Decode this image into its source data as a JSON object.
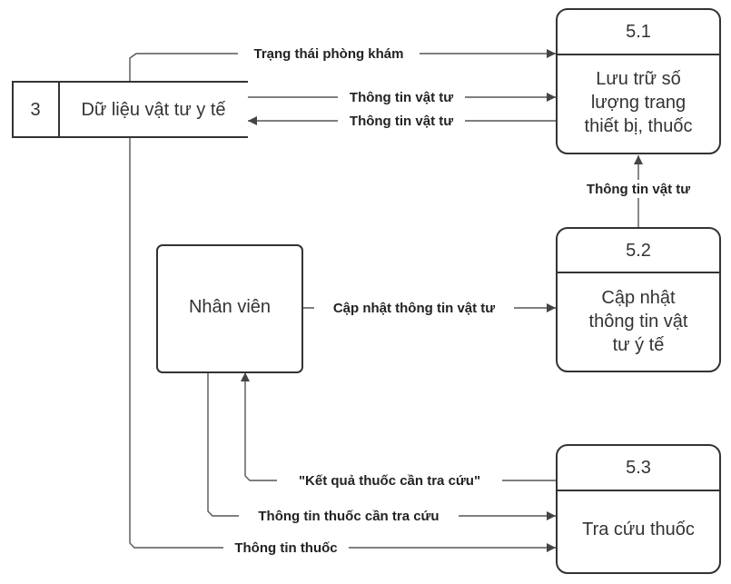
{
  "processes": [
    {
      "id": "5.1",
      "lines": [
        "Lưu trữ số",
        "lượng trang",
        "thiết bị, thuốc"
      ]
    },
    {
      "id": "5.2",
      "lines": [
        "Cập nhật",
        "thông tin vật",
        "tư ý tế"
      ]
    },
    {
      "id": "5.3",
      "lines": [
        "Tra cứu thuốc"
      ]
    }
  ],
  "datastore": {
    "id": "3",
    "name": "Dữ liệu vật tư y tế"
  },
  "entity": {
    "name": "Nhân viên"
  },
  "flows": {
    "trang_thai": "Trạng thái phòng khám",
    "ttvt_to_51": "Thông tin vật tư",
    "ttvt_from_51": "Thông tin vật tư",
    "ttvt_52_51": "Thông tin vật tư",
    "cap_nhat": "Cập nhật thông tin vật tư",
    "ket_qua": "\"Kết quả thuốc cần tra cứu\"",
    "tt_thuoc_can": "Thông tin thuốc cần tra cứu",
    "tt_thuoc": "Thông tin thuốc"
  }
}
